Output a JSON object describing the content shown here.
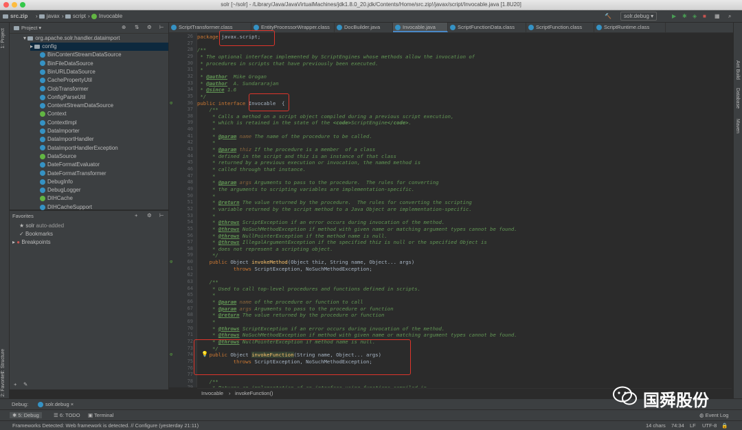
{
  "window": {
    "title": "solr [~/solr] - /Library/Java/JavaVirtualMachines/jdk1.8.0_20.jdk/Contents/Home/src.zip!/javax/script/Invocable.java [1.8U20]"
  },
  "navbar": {
    "crumbs": [
      "src.zip",
      "javax",
      "script",
      "Invocable"
    ],
    "run_config": "solr.debug"
  },
  "left_strip": {
    "project_tab": "1: Project",
    "structure_tab": "7: Structure",
    "favorites_tab": "2: Favorites"
  },
  "right_strip": {
    "ant_tab": "Ant Build",
    "db_tab": "Database",
    "maven_tab": "Maven"
  },
  "project_panel": {
    "title": "Project",
    "package": "org.apache.solr.handler.dataimport",
    "folder": "config",
    "classes": [
      "BinContentStreamDataSource",
      "BinFileDataSource",
      "BinURLDataSource",
      "CachePropertyUtil",
      "ClobTransformer",
      "ConfigParseUtil",
      "ContentStreamDataSource",
      "Context",
      "ContextImpl",
      "DataImporter",
      "DataImportHandler",
      "DataImportHandlerException",
      "DataSource",
      "DateFormatEvaluator",
      "DateFormatTransformer",
      "DebugInfo",
      "DebugLogger",
      "DIHCache",
      "DIHCacheSupport"
    ]
  },
  "favorites_panel": {
    "title": "Favorites",
    "items": [
      "solr",
      "auto-added",
      "Bookmarks",
      "Breakpoints"
    ]
  },
  "editor_tabs": [
    "ScriptTransformer.class",
    "EntityProcessorWrapper.class",
    "DocBuilder.java",
    "Invocable.java",
    "ScriptFunctionData.class",
    "ScriptFunction.class",
    "ScriptRuntime.class"
  ],
  "active_tab": "Invocable.java",
  "code_lines": [
    {
      "n": "26",
      "t": "package javax.script;"
    },
    {
      "n": "27",
      "t": ""
    },
    {
      "n": "28",
      "t": "/**"
    },
    {
      "n": "29",
      "t": " * The optional interface implemented by ScriptEngines whose methods allow the invocation of"
    },
    {
      "n": "30",
      "t": " * procedures in scripts that have previously been executed."
    },
    {
      "n": "31",
      "t": " *"
    },
    {
      "n": "32",
      "t": " * @author  Mike Grogan"
    },
    {
      "n": "33",
      "t": " * @author  A. Sundararajan"
    },
    {
      "n": "34",
      "t": " * @since 1.6"
    },
    {
      "n": "35",
      "t": " */"
    },
    {
      "n": "36",
      "t": "public interface Invocable  {"
    },
    {
      "n": "37",
      "t": "    /**"
    },
    {
      "n": "38",
      "t": "     * Calls a method on a script object compiled during a previous script execution,"
    },
    {
      "n": "39",
      "t": "     * which is retained in the state of the <code>ScriptEngine</code>."
    },
    {
      "n": "40",
      "t": "     *"
    },
    {
      "n": "41",
      "t": "     * @param name The name of the procedure to be called."
    },
    {
      "n": "42",
      "t": "     *"
    },
    {
      "n": "43",
      "t": "     * @param thiz If the procedure is a member  of a class"
    },
    {
      "n": "44",
      "t": "     * defined in the script and thiz is an instance of that class"
    },
    {
      "n": "45",
      "t": "     * returned by a previous execution or invocation, the named method is"
    },
    {
      "n": "46",
      "t": "     * called through that instance."
    },
    {
      "n": "47",
      "t": "     *"
    },
    {
      "n": "48",
      "t": "     * @param args Arguments to pass to the procedure.  The rules for converting"
    },
    {
      "n": "49",
      "t": "     * the arguments to scripting variables are implementation-specific."
    },
    {
      "n": "50",
      "t": "     *"
    },
    {
      "n": "51",
      "t": "     * @return The value returned by the procedure.  The rules for converting the scripting"
    },
    {
      "n": "52",
      "t": "     * variable returned by the script method to a Java Object are implementation-specific."
    },
    {
      "n": "53",
      "t": "     *"
    },
    {
      "n": "54",
      "t": "     * @throws ScriptException if an error occurs during invocation of the method."
    },
    {
      "n": "55",
      "t": "     * @throws NoSuchMethodException if method with given name or matching argument types cannot be found."
    },
    {
      "n": "56",
      "t": "     * @throws NullPointerException if the method name is null."
    },
    {
      "n": "57",
      "t": "     * @throws IllegalArgumentException if the specified thiz is null or the specified Object is"
    },
    {
      "n": "58",
      "t": "     * does not represent a scripting object."
    },
    {
      "n": "59",
      "t": "     */"
    },
    {
      "n": "60",
      "t": "    public Object invokeMethod(Object thiz, String name, Object... args)"
    },
    {
      "n": "61",
      "t": "            throws ScriptException, NoSuchMethodException;"
    },
    {
      "n": "62",
      "t": ""
    },
    {
      "n": "63",
      "t": "    /**"
    },
    {
      "n": "64",
      "t": "     * Used to call top-level procedures and functions defined in scripts."
    },
    {
      "n": "65",
      "t": "     *"
    },
    {
      "n": "66",
      "t": "     * @param name of the procedure or function to call"
    },
    {
      "n": "67",
      "t": "     * @param args Arguments to pass to the procedure or function"
    },
    {
      "n": "68",
      "t": "     * @return The value returned by the procedure or function"
    },
    {
      "n": "69",
      "t": "     *"
    },
    {
      "n": "70",
      "t": "     * @throws ScriptException if an error occurs during invocation of the method."
    },
    {
      "n": "71",
      "t": "     * @throws NoSuchMethodException if method with given name or matching argument types cannot be found."
    },
    {
      "n": "72",
      "t": "     * @throws NullPointerException if method name is null."
    },
    {
      "n": "73",
      "t": "     */"
    },
    {
      "n": "74",
      "t": "    public Object invokeFunction(String name, Object... args)"
    },
    {
      "n": "75",
      "t": "            throws ScriptException, NoSuchMethodException;"
    },
    {
      "n": "76",
      "t": ""
    },
    {
      "n": "77",
      "t": ""
    },
    {
      "n": "78",
      "t": "    /**"
    },
    {
      "n": "79",
      "t": "     * Returns an implementation of an interface using functions compiled in"
    }
  ],
  "editor_breadcrumb": [
    "Invocable",
    "invokeFunction()"
  ],
  "debug_bar": {
    "label": "Debug:",
    "config": "solr.debug"
  },
  "bottom_tabs": [
    "5: Debug",
    "6: TODO",
    "Terminal"
  ],
  "event_log": "Event Log",
  "status": {
    "message": "Frameworks Detected: Web framework is detected. // Configure (yesterday 21:11)",
    "chars": "14 chars",
    "position": "74:34",
    "line_sep": "LF",
    "encoding": "UTF-8"
  },
  "watermark": {
    "text": "国舜股份"
  },
  "colors": {
    "accent": "#4a88c7",
    "highlight_box": "#e0352b",
    "comment": "#629755",
    "keyword": "#cc7832"
  }
}
